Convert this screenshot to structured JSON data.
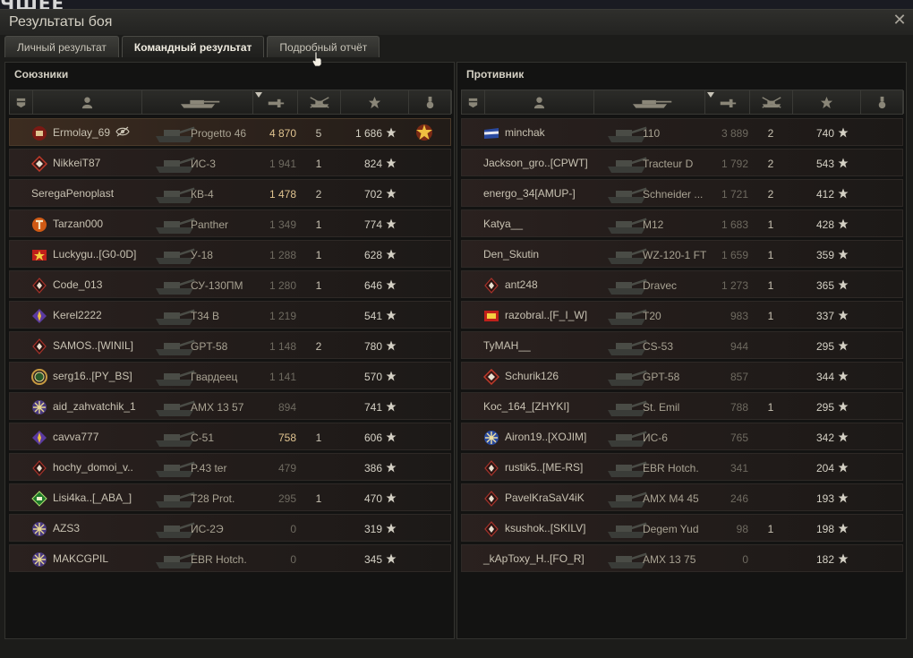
{
  "top_text": "ЧШЕЕ",
  "window": {
    "title": "Результаты боя",
    "close_glyph": "✕"
  },
  "tabs": [
    {
      "label": "Личный результат",
      "active": false
    },
    {
      "label": "Командный результат",
      "active": true
    },
    {
      "label": "Подробный отчёт",
      "active": false
    }
  ],
  "header_icons": [
    "platoon-icon",
    "player-icon",
    "vehicle-icon",
    "damage-icon",
    "frags-icon",
    "xp-icon",
    "medal-icon"
  ],
  "colors": {
    "highlight_damage": "#e0c490",
    "dim_damage": "#6e6a60"
  },
  "allies": {
    "title": "Союзники",
    "rows": [
      {
        "player": "Ermolay_69",
        "badge": "red",
        "eye": true,
        "vehicle": "Progetto 46",
        "damage": "4 870",
        "frags": "5",
        "xp": "1 686",
        "me": true,
        "hi": true,
        "medal": true
      },
      {
        "player": "NikkeiT87",
        "badge": "diamond-red",
        "vehicle": "ИС-3",
        "damage": "1 941",
        "frags": "1",
        "xp": "824"
      },
      {
        "player": "SeregaPenoplast",
        "badge": "",
        "vehicle": "КВ-4",
        "damage": "1 478",
        "frags": "2",
        "xp": "702",
        "hi": true
      },
      {
        "player": "Tarzan000",
        "badge": "orange",
        "vehicle": "Panther",
        "damage": "1 349",
        "frags": "1",
        "xp": "774"
      },
      {
        "player": "Luckygu..[G0-0D]",
        "badge": "star-red",
        "vehicle": "У-18",
        "damage": "1 288",
        "frags": "1",
        "xp": "628"
      },
      {
        "player": "Code_013",
        "badge": "diamond",
        "vehicle": "СУ-130ПМ",
        "damage": "1 280",
        "frags": "1",
        "xp": "646"
      },
      {
        "player": "Kerel2222",
        "badge": "purple",
        "vehicle": "T34 B",
        "damage": "1 219",
        "frags": "",
        "xp": "541"
      },
      {
        "player": "SAMOS..[WINIL]",
        "badge": "diamond",
        "vehicle": "GPT-58",
        "damage": "1 148",
        "frags": "2",
        "xp": "780"
      },
      {
        "player": "serg16..[PY_BS]",
        "badge": "green-ring",
        "vehicle": "Гвардеец",
        "damage": "1 141",
        "frags": "",
        "xp": "570"
      },
      {
        "player": "aid_zahvatchik_1",
        "badge": "snow",
        "vehicle": "AMX 13 57",
        "damage": "894",
        "frags": "",
        "xp": "741"
      },
      {
        "player": "cavva777",
        "badge": "purple",
        "vehicle": "С-51",
        "damage": "758",
        "frags": "1",
        "xp": "606",
        "hi": true
      },
      {
        "player": "hochy_domoi_v..",
        "badge": "diamond",
        "vehicle": "P.43 ter",
        "damage": "479",
        "frags": "",
        "xp": "386"
      },
      {
        "player": "Lisi4ka..[_ABA_]",
        "badge": "green",
        "vehicle": "T28 Prot.",
        "damage": "295",
        "frags": "1",
        "xp": "470"
      },
      {
        "player": "AZS3",
        "badge": "snow",
        "vehicle": "ИС-2Э",
        "damage": "0",
        "frags": "",
        "xp": "319"
      },
      {
        "player": "MAKCGPIL",
        "badge": "snow",
        "vehicle": "EBR Hotch.",
        "damage": "0",
        "frags": "",
        "xp": "345"
      }
    ]
  },
  "enemies": {
    "title": "Противник",
    "rows": [
      {
        "player": "minchak",
        "badge": "flag",
        "vehicle": "110",
        "damage": "3 889",
        "frags": "2",
        "xp": "740"
      },
      {
        "player": "Jackson_gro..[CPWT]",
        "badge": "",
        "vehicle": "Tracteur D",
        "damage": "1 792",
        "frags": "2",
        "xp": "543"
      },
      {
        "player": "energo_34[AMUP-]",
        "badge": "",
        "vehicle": "Schneider ...",
        "damage": "1 721",
        "frags": "2",
        "xp": "412"
      },
      {
        "player": "Katya__",
        "badge": "",
        "vehicle": "M12",
        "damage": "1 683",
        "frags": "1",
        "xp": "428"
      },
      {
        "player": "Den_Skutin",
        "badge": "",
        "vehicle": "WZ-120-1 FT",
        "damage": "1 659",
        "frags": "1",
        "xp": "359"
      },
      {
        "player": "ant248",
        "badge": "diamond",
        "vehicle": "Dravec",
        "damage": "1 273",
        "frags": "1",
        "xp": "365"
      },
      {
        "player": "razobral..[F_I_W]",
        "badge": "red-square",
        "vehicle": "T20",
        "damage": "983",
        "frags": "1",
        "xp": "337"
      },
      {
        "player": "TyMAH__",
        "badge": "",
        "vehicle": "CS-53",
        "damage": "944",
        "frags": "",
        "xp": "295"
      },
      {
        "player": "Schurik126",
        "badge": "diamond-red",
        "vehicle": "GPT-58",
        "damage": "857",
        "frags": "",
        "xp": "344"
      },
      {
        "player": "Koc_164_[ZHYKI]",
        "badge": "",
        "vehicle": "St. Emil",
        "damage": "788",
        "frags": "1",
        "xp": "295"
      },
      {
        "player": "Airon19..[XOJIM]",
        "badge": "snow-blue",
        "vehicle": "ИС-6",
        "damage": "765",
        "frags": "",
        "xp": "342"
      },
      {
        "player": "rustik5..[ME-RS]",
        "badge": "diamond",
        "vehicle": "EBR Hotch.",
        "damage": "341",
        "frags": "",
        "xp": "204"
      },
      {
        "player": "PavelKraSaV4iK",
        "badge": "diamond",
        "vehicle": "AMX M4 45",
        "damage": "246",
        "frags": "",
        "xp": "193"
      },
      {
        "player": "ksushok..[SKILV]",
        "badge": "diamond",
        "vehicle": "Degem Yud",
        "damage": "98",
        "frags": "1",
        "xp": "198"
      },
      {
        "player": "_kApToxy_H..[FO_R]",
        "badge": "",
        "vehicle": "AMX 13 75",
        "damage": "0",
        "frags": "",
        "xp": "182"
      }
    ]
  }
}
